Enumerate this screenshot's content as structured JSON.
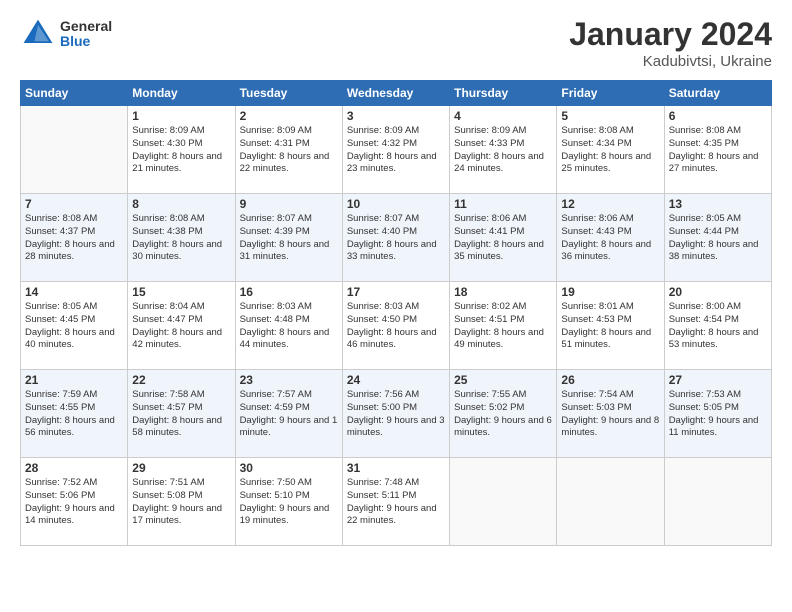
{
  "header": {
    "logo_general": "General",
    "logo_blue": "Blue",
    "month_title": "January 2024",
    "location": "Kadubivtsi, Ukraine"
  },
  "days_of_week": [
    "Sunday",
    "Monday",
    "Tuesday",
    "Wednesday",
    "Thursday",
    "Friday",
    "Saturday"
  ],
  "weeks": [
    [
      {
        "day": "",
        "sunrise": "",
        "sunset": "",
        "daylight": ""
      },
      {
        "day": "1",
        "sunrise": "Sunrise: 8:09 AM",
        "sunset": "Sunset: 4:30 PM",
        "daylight": "Daylight: 8 hours and 21 minutes."
      },
      {
        "day": "2",
        "sunrise": "Sunrise: 8:09 AM",
        "sunset": "Sunset: 4:31 PM",
        "daylight": "Daylight: 8 hours and 22 minutes."
      },
      {
        "day": "3",
        "sunrise": "Sunrise: 8:09 AM",
        "sunset": "Sunset: 4:32 PM",
        "daylight": "Daylight: 8 hours and 23 minutes."
      },
      {
        "day": "4",
        "sunrise": "Sunrise: 8:09 AM",
        "sunset": "Sunset: 4:33 PM",
        "daylight": "Daylight: 8 hours and 24 minutes."
      },
      {
        "day": "5",
        "sunrise": "Sunrise: 8:08 AM",
        "sunset": "Sunset: 4:34 PM",
        "daylight": "Daylight: 8 hours and 25 minutes."
      },
      {
        "day": "6",
        "sunrise": "Sunrise: 8:08 AM",
        "sunset": "Sunset: 4:35 PM",
        "daylight": "Daylight: 8 hours and 27 minutes."
      }
    ],
    [
      {
        "day": "7",
        "sunrise": "Sunrise: 8:08 AM",
        "sunset": "Sunset: 4:37 PM",
        "daylight": "Daylight: 8 hours and 28 minutes."
      },
      {
        "day": "8",
        "sunrise": "Sunrise: 8:08 AM",
        "sunset": "Sunset: 4:38 PM",
        "daylight": "Daylight: 8 hours and 30 minutes."
      },
      {
        "day": "9",
        "sunrise": "Sunrise: 8:07 AM",
        "sunset": "Sunset: 4:39 PM",
        "daylight": "Daylight: 8 hours and 31 minutes."
      },
      {
        "day": "10",
        "sunrise": "Sunrise: 8:07 AM",
        "sunset": "Sunset: 4:40 PM",
        "daylight": "Daylight: 8 hours and 33 minutes."
      },
      {
        "day": "11",
        "sunrise": "Sunrise: 8:06 AM",
        "sunset": "Sunset: 4:41 PM",
        "daylight": "Daylight: 8 hours and 35 minutes."
      },
      {
        "day": "12",
        "sunrise": "Sunrise: 8:06 AM",
        "sunset": "Sunset: 4:43 PM",
        "daylight": "Daylight: 8 hours and 36 minutes."
      },
      {
        "day": "13",
        "sunrise": "Sunrise: 8:05 AM",
        "sunset": "Sunset: 4:44 PM",
        "daylight": "Daylight: 8 hours and 38 minutes."
      }
    ],
    [
      {
        "day": "14",
        "sunrise": "Sunrise: 8:05 AM",
        "sunset": "Sunset: 4:45 PM",
        "daylight": "Daylight: 8 hours and 40 minutes."
      },
      {
        "day": "15",
        "sunrise": "Sunrise: 8:04 AM",
        "sunset": "Sunset: 4:47 PM",
        "daylight": "Daylight: 8 hours and 42 minutes."
      },
      {
        "day": "16",
        "sunrise": "Sunrise: 8:03 AM",
        "sunset": "Sunset: 4:48 PM",
        "daylight": "Daylight: 8 hours and 44 minutes."
      },
      {
        "day": "17",
        "sunrise": "Sunrise: 8:03 AM",
        "sunset": "Sunset: 4:50 PM",
        "daylight": "Daylight: 8 hours and 46 minutes."
      },
      {
        "day": "18",
        "sunrise": "Sunrise: 8:02 AM",
        "sunset": "Sunset: 4:51 PM",
        "daylight": "Daylight: 8 hours and 49 minutes."
      },
      {
        "day": "19",
        "sunrise": "Sunrise: 8:01 AM",
        "sunset": "Sunset: 4:53 PM",
        "daylight": "Daylight: 8 hours and 51 minutes."
      },
      {
        "day": "20",
        "sunrise": "Sunrise: 8:00 AM",
        "sunset": "Sunset: 4:54 PM",
        "daylight": "Daylight: 8 hours and 53 minutes."
      }
    ],
    [
      {
        "day": "21",
        "sunrise": "Sunrise: 7:59 AM",
        "sunset": "Sunset: 4:55 PM",
        "daylight": "Daylight: 8 hours and 56 minutes."
      },
      {
        "day": "22",
        "sunrise": "Sunrise: 7:58 AM",
        "sunset": "Sunset: 4:57 PM",
        "daylight": "Daylight: 8 hours and 58 minutes."
      },
      {
        "day": "23",
        "sunrise": "Sunrise: 7:57 AM",
        "sunset": "Sunset: 4:59 PM",
        "daylight": "Daylight: 9 hours and 1 minute."
      },
      {
        "day": "24",
        "sunrise": "Sunrise: 7:56 AM",
        "sunset": "Sunset: 5:00 PM",
        "daylight": "Daylight: 9 hours and 3 minutes."
      },
      {
        "day": "25",
        "sunrise": "Sunrise: 7:55 AM",
        "sunset": "Sunset: 5:02 PM",
        "daylight": "Daylight: 9 hours and 6 minutes."
      },
      {
        "day": "26",
        "sunrise": "Sunrise: 7:54 AM",
        "sunset": "Sunset: 5:03 PM",
        "daylight": "Daylight: 9 hours and 8 minutes."
      },
      {
        "day": "27",
        "sunrise": "Sunrise: 7:53 AM",
        "sunset": "Sunset: 5:05 PM",
        "daylight": "Daylight: 9 hours and 11 minutes."
      }
    ],
    [
      {
        "day": "28",
        "sunrise": "Sunrise: 7:52 AM",
        "sunset": "Sunset: 5:06 PM",
        "daylight": "Daylight: 9 hours and 14 minutes."
      },
      {
        "day": "29",
        "sunrise": "Sunrise: 7:51 AM",
        "sunset": "Sunset: 5:08 PM",
        "daylight": "Daylight: 9 hours and 17 minutes."
      },
      {
        "day": "30",
        "sunrise": "Sunrise: 7:50 AM",
        "sunset": "Sunset: 5:10 PM",
        "daylight": "Daylight: 9 hours and 19 minutes."
      },
      {
        "day": "31",
        "sunrise": "Sunrise: 7:48 AM",
        "sunset": "Sunset: 5:11 PM",
        "daylight": "Daylight: 9 hours and 22 minutes."
      },
      {
        "day": "",
        "sunrise": "",
        "sunset": "",
        "daylight": ""
      },
      {
        "day": "",
        "sunrise": "",
        "sunset": "",
        "daylight": ""
      },
      {
        "day": "",
        "sunrise": "",
        "sunset": "",
        "daylight": ""
      }
    ]
  ]
}
